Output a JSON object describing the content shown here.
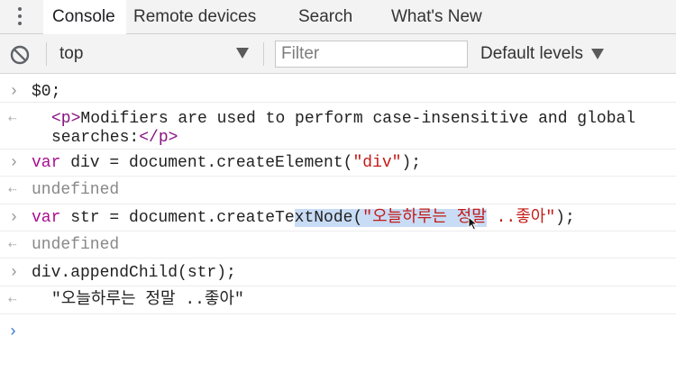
{
  "tabs": [
    {
      "label": "Console",
      "active": true
    },
    {
      "label": "Remote devices",
      "active": false
    },
    {
      "label": "Search",
      "active": false
    },
    {
      "label": "What's New",
      "active": false
    }
  ],
  "toolbar": {
    "context": "top",
    "filter_placeholder": "Filter",
    "levels_label": "Default levels"
  },
  "console": {
    "entries": [
      {
        "type": "input",
        "text": "$0;"
      },
      {
        "type": "output",
        "tag_open": "<p>",
        "text_line1": "Modifiers are used to perform case-insensitive and global",
        "text_line2": "searches:",
        "tag_close": "</p>"
      },
      {
        "type": "input",
        "kw": "var",
        "name": " div = document.createElement(",
        "arg": "\"div\"",
        "end": ");"
      },
      {
        "type": "output",
        "text": "undefined"
      },
      {
        "type": "input",
        "kw": "var",
        "name_a": " str = document.createTe",
        "name_sel": "xtNode(",
        "arg_sel": "\"오늘하루는 정말",
        "arg_rest": " ..좋아\"",
        "end": ");"
      },
      {
        "type": "output",
        "text": "undefined"
      },
      {
        "type": "input",
        "text": "div.appendChild(str);"
      },
      {
        "type": "output",
        "text": "\"오늘하루는 정말 ..좋아\""
      }
    ]
  },
  "colors": {
    "keyword": "#a90d91",
    "string": "#c41a16",
    "muted": "#888888",
    "selection": "#c8dcf6",
    "prompt_caret": "#3a7bd5"
  },
  "icons": {
    "menu": "kebab-menu-icon",
    "clear": "clear-console-icon",
    "dropdown": "dropdown-arrow-icon",
    "prompt": "chevron-right-icon",
    "result": "result-arrow-icon",
    "cursor": "mouse-cursor-icon"
  }
}
